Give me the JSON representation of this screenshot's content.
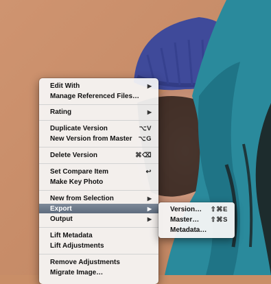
{
  "menu": {
    "items": [
      {
        "label": "Edit With",
        "shortcut": "",
        "arrow": "▶"
      },
      {
        "label": "Manage Referenced Files…",
        "shortcut": "",
        "arrow": ""
      },
      {
        "label": "Rating",
        "shortcut": "",
        "arrow": "▶"
      },
      {
        "label": "Duplicate Version",
        "shortcut": "⌥V",
        "arrow": ""
      },
      {
        "label": "New Version from Master",
        "shortcut": "⌥G",
        "arrow": ""
      },
      {
        "label": "Delete Version",
        "shortcut": "⌘⌫",
        "arrow": ""
      },
      {
        "label": "Set Compare Item",
        "shortcut": "↩",
        "arrow": ""
      },
      {
        "label": "Make Key Photo",
        "shortcut": "",
        "arrow": ""
      },
      {
        "label": "New from Selection",
        "shortcut": "",
        "arrow": "▶"
      },
      {
        "label": "Export",
        "shortcut": "",
        "arrow": "▶"
      },
      {
        "label": "Output",
        "shortcut": "",
        "arrow": "▶"
      },
      {
        "label": "Lift Metadata",
        "shortcut": "",
        "arrow": ""
      },
      {
        "label": "Lift Adjustments",
        "shortcut": "",
        "arrow": ""
      },
      {
        "label": "Remove Adjustments",
        "shortcut": "",
        "arrow": ""
      },
      {
        "label": "Migrate Image…",
        "shortcut": "",
        "arrow": ""
      }
    ]
  },
  "submenu": {
    "items": [
      {
        "label": "Version…",
        "shortcut": "⇧⌘E"
      },
      {
        "label": "Master…",
        "shortcut": "⇧⌘S"
      },
      {
        "label": "Metadata…",
        "shortcut": ""
      }
    ]
  },
  "colors": {
    "background": "#c98e67",
    "selection": "#6b7788",
    "jacket": "#2a8a9c",
    "hat": "#3f4a9a"
  }
}
